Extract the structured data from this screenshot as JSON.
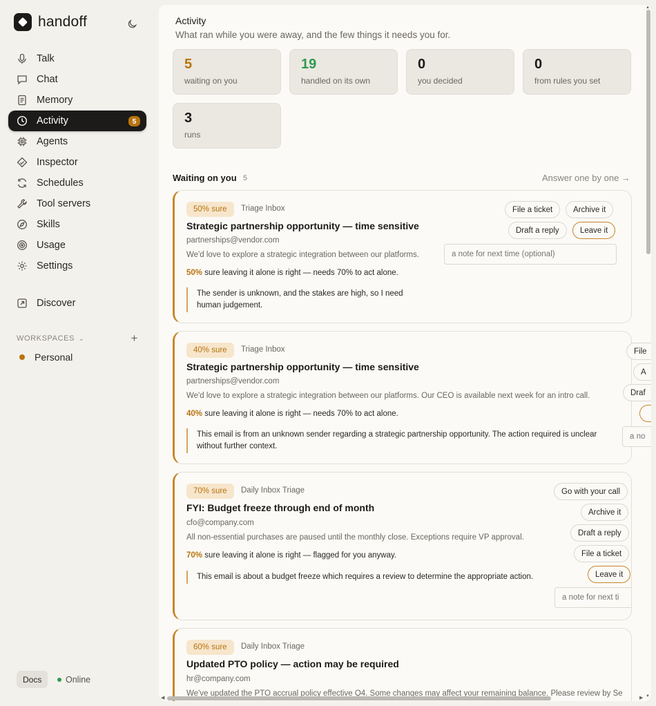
{
  "app": {
    "name": "handoff"
  },
  "nav": [
    {
      "label": "Talk",
      "icon": "microphone-icon"
    },
    {
      "label": "Chat",
      "icon": "chat-icon"
    },
    {
      "label": "Memory",
      "icon": "document-icon"
    },
    {
      "label": "Activity",
      "icon": "clock-icon",
      "badge": "5",
      "active": true
    },
    {
      "label": "Agents",
      "icon": "chip-icon"
    },
    {
      "label": "Inspector",
      "icon": "diamond-icon"
    },
    {
      "label": "Schedules",
      "icon": "refresh-icon"
    },
    {
      "label": "Tool servers",
      "icon": "wrench-icon"
    },
    {
      "label": "Skills",
      "icon": "compass-icon"
    },
    {
      "label": "Usage",
      "icon": "target-icon"
    },
    {
      "label": "Settings",
      "icon": "gear-icon"
    }
  ],
  "discover": {
    "label": "Discover",
    "icon": "external-link-icon"
  },
  "workspaces": {
    "heading": "WORKSPACES",
    "items": [
      {
        "label": "Personal"
      }
    ]
  },
  "footer": {
    "docs": "Docs",
    "status": "Online"
  },
  "page": {
    "title": "Activity",
    "subtitle": "What ran while you were away, and the few things it needs you for."
  },
  "stats": [
    {
      "value": "5",
      "label": "waiting on you",
      "color": "#b8730f"
    },
    {
      "value": "19",
      "label": "handled on its own",
      "color": "#2f9a4f"
    },
    {
      "value": "0",
      "label": "you decided",
      "color": "#1c1b19"
    },
    {
      "value": "0",
      "label": "from rules you set",
      "color": "#1c1b19"
    },
    {
      "value": "3",
      "label": "runs",
      "color": "#1c1b19"
    }
  ],
  "waiting": {
    "title": "Waiting on you",
    "count": "5",
    "link": "Answer one by one →"
  },
  "cards": [
    {
      "confidence": "50% sure",
      "source": "Triage Inbox",
      "title": "Strategic partnership opportunity — time sensitive",
      "sender": "partnerships@vendor.com",
      "preview": "We'd love to explore a strategic integration between our platforms.",
      "sure_pct": "50%",
      "sure_text": " sure leaving it alone is right — needs 70% to act alone.",
      "reason": "The sender is unknown, and the stakes are high, so I need human judgement.",
      "actions": [
        "File a ticket",
        "Archive it",
        "Draft a reply",
        "Leave it"
      ],
      "note_placeholder": "a note for next time (optional)"
    },
    {
      "confidence": "40% sure",
      "source": "Triage Inbox",
      "title": "Strategic partnership opportunity — time sensitive",
      "sender": "partnerships@vendor.com",
      "preview": "We'd love to explore a strategic integration between our platforms. Our CEO is available next week for an intro call.",
      "sure_pct": "40%",
      "sure_text": " sure leaving it alone is right — needs 70% to act alone.",
      "reason": "This email is from an unknown sender regarding a strategic partnership opportunity. The action required is unclear without further context.",
      "actions": [
        "File",
        "A",
        "Draf",
        ""
      ],
      "note_placeholder": "a no"
    },
    {
      "confidence": "70% sure",
      "source": "Daily Inbox Triage",
      "title": "FYI: Budget freeze through end of month",
      "sender": "cfo@company.com",
      "preview": "All non-essential purchases are paused until the monthly close. Exceptions require VP approval.",
      "sure_pct": "70%",
      "sure_text": " sure leaving it alone is right — flagged for you anyway.",
      "reason": "This email is about a budget freeze which requires a review to determine the appropriate action.",
      "actions": [
        "Go with your call",
        "Archive it",
        "Draft a reply",
        "File a ticket",
        "Leave it"
      ],
      "note_placeholder": "a note for next ti"
    },
    {
      "confidence": "60% sure",
      "source": "Daily Inbox Triage",
      "title": "Updated PTO policy — action may be required",
      "sender": "hr@company.com",
      "preview": "We've updated the PTO accrual policy effective Q4. Some changes may affect your remaining balance. Please review by Se"
    }
  ]
}
